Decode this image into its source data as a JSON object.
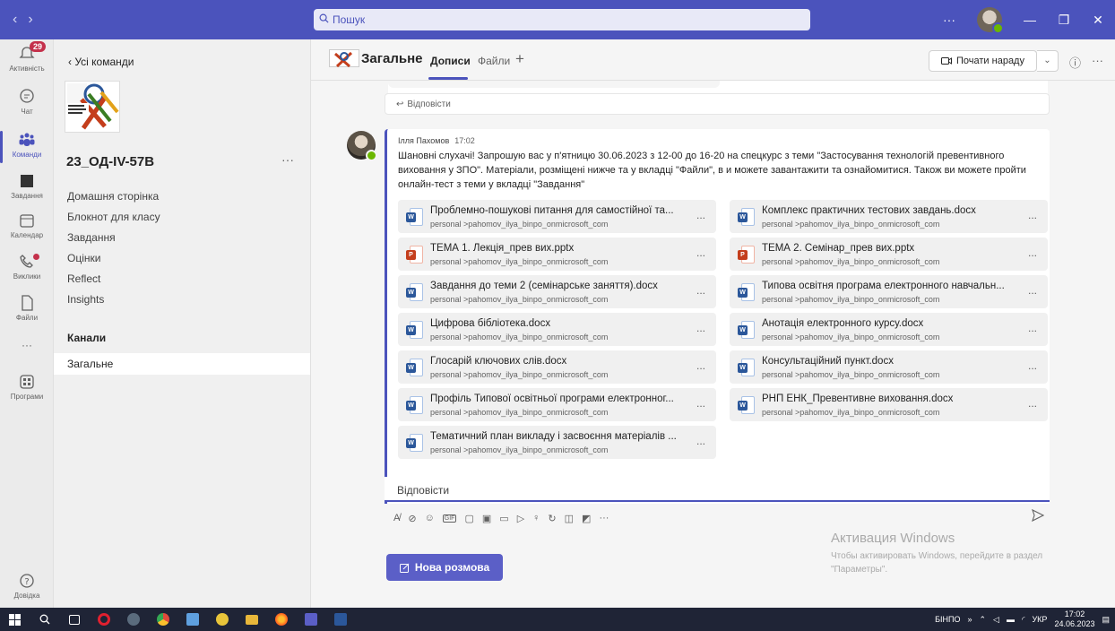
{
  "titlebar": {
    "back_glyph": "‹",
    "forward_glyph": "›",
    "search_placeholder": "Пошук",
    "more": "···",
    "minimize": "—",
    "maximize": "❐",
    "close": "✕"
  },
  "rail": {
    "items": [
      {
        "label": "Активність",
        "icon": "bell-icon",
        "badge": "29"
      },
      {
        "label": "Чат",
        "icon": "chat-icon"
      },
      {
        "label": "Команди",
        "icon": "teams-icon"
      },
      {
        "label": "Завдання",
        "icon": "assignments-icon"
      },
      {
        "label": "Календар",
        "icon": "calendar-icon"
      },
      {
        "label": "Виклики",
        "icon": "phone-icon"
      },
      {
        "label": "Файли",
        "icon": "file-icon"
      },
      {
        "label": "···",
        "icon": "more-icon"
      },
      {
        "label": "Програми",
        "icon": "apps-icon"
      },
      {
        "label": "Довідка",
        "icon": "help-icon"
      }
    ]
  },
  "team_panel": {
    "back_label": "Усі команди",
    "team_name": "23_ОД-IV-57B",
    "more": "···",
    "nav": [
      "Домашня сторінка",
      "Блокнот для класу",
      "Завдання",
      "Оцінки",
      "Reflect",
      "Insights"
    ],
    "channels_heading": "Канали",
    "channels": [
      "Загальне"
    ]
  },
  "header": {
    "channel_title": "Загальне",
    "tabs": [
      "Дописи",
      "Файли"
    ],
    "add_tab": "+",
    "meet_button": "Почати нараду",
    "info_icon": "ⓘ",
    "more": "···"
  },
  "previous_message": {
    "reply_label": "Відповісти"
  },
  "message": {
    "author": "Ілля Пахомов",
    "time": "17:02",
    "body": "Шановні слухачі! Запрошую вас у п'ятницю 30.06.2023 з 12-00 до 16-20 на спецкурс з теми \"Застосування технологій превентивного виховання у ЗПО\". Матеріали, розміщені нижче та у вкладці \"Файли\", в и можете завантажити та ознайомитися. Також ви можете пройти онлайн-тест з теми у вкладці \"Завдання\"",
    "files": [
      {
        "name": "Проблемно-пошукові питання для самостійної та...",
        "path": "personal >pahomov_ilya_binpo_onmicrosoft_com",
        "type": "word"
      },
      {
        "name": "Комплекс практичних тестових завдань.docx",
        "path": "personal >pahomov_ilya_binpo_onmicrosoft_com",
        "type": "word"
      },
      {
        "name": "ТЕМА 1. Лекція_прев вих.pptx",
        "path": "personal >pahomov_ilya_binpo_onmicrosoft_com",
        "type": "ppt"
      },
      {
        "name": "ТЕМА 2. Семінар_прев вих.pptx",
        "path": "personal >pahomov_ilya_binpo_onmicrosoft_com",
        "type": "ppt"
      },
      {
        "name": "Завдання до теми 2 (семінарське заняття).docx",
        "path": "personal >pahomov_ilya_binpo_onmicrosoft_com",
        "type": "word"
      },
      {
        "name": "Типова освітня програма електронного навчальн...",
        "path": "personal >pahomov_ilya_binpo_onmicrosoft_com",
        "type": "word"
      },
      {
        "name": "Цифрова бібліотека.docx",
        "path": "personal >pahomov_ilya_binpo_onmicrosoft_com",
        "type": "word"
      },
      {
        "name": "Анотація електронного курсу.docx",
        "path": "personal >pahomov_ilya_binpo_onmicrosoft_com",
        "type": "word"
      },
      {
        "name": "Глосарій ключових слів.docx",
        "path": "personal >pahomov_ilya_binpo_onmicrosoft_com",
        "type": "word"
      },
      {
        "name": "Консультаційний пункт.docx",
        "path": "personal >pahomov_ilya_binpo_onmicrosoft_com",
        "type": "word"
      },
      {
        "name": "Профіль Типової освітньої програми електронног...",
        "path": "personal >pahomov_ilya_binpo_onmicrosoft_com",
        "type": "word"
      },
      {
        "name": "РНП ЕНК_Превентивне виховання.docx",
        "path": "personal >pahomov_ilya_binpo_onmicrosoft_com",
        "type": "word"
      },
      {
        "name": "Тематичний план викладу і засвоєння матеріалів ...",
        "path": "personal >pahomov_ilya_binpo_onmicrosoft_com",
        "type": "word"
      }
    ],
    "file_more": "...",
    "reply_label": "Відповісти"
  },
  "compose": {
    "toolbar_more": "···",
    "new_conversation": "Нова розмова"
  },
  "activation": {
    "title": "Активация Windows",
    "line1": "Чтобы активировать Windows, перейдите в раздел",
    "line2": "\"Параметры\"."
  },
  "taskbar": {
    "lang_label": "БІНПО",
    "keyboard": "УКР",
    "time": "17:02",
    "date": "24.06.2023",
    "overflow": "»"
  },
  "colors": {
    "accent": "#4b53bc",
    "presence": "#6bb700",
    "badge": "#c4314b"
  }
}
